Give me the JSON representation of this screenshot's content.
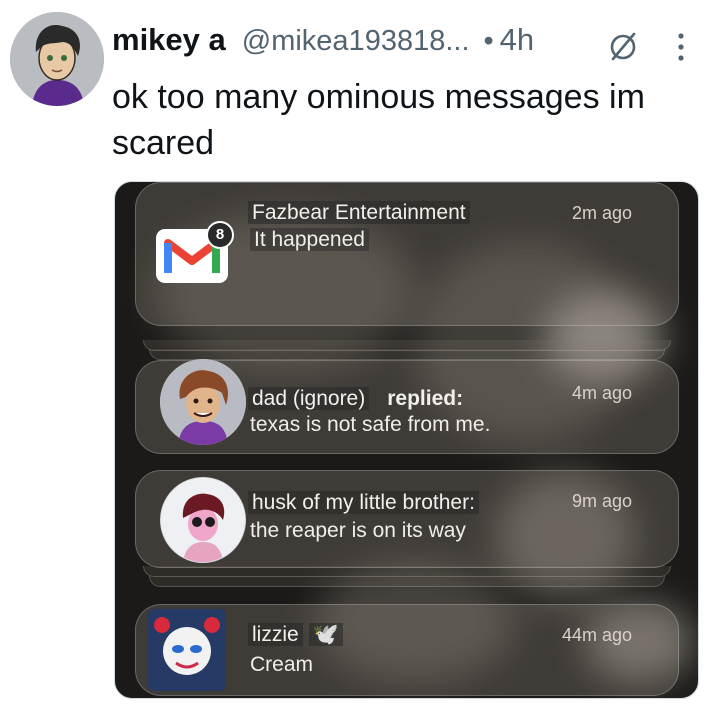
{
  "tweet": {
    "display_name": "mikey a",
    "handle": "@mikea193818...",
    "separator": "•",
    "age": "4h",
    "text": "ok too many ominous messages im scared",
    "icons": {
      "grok": "circle-slash-icon",
      "more": "vertical-dots-icon"
    }
  },
  "notifications": [
    {
      "app_icon": "gmail-icon",
      "badge_count": "8",
      "sender": "Fazbear Entertainment",
      "message": "It happened",
      "time": "2m ago"
    },
    {
      "sender": "dad (ignore)",
      "action": "replied:",
      "message": "texas is not safe from me.",
      "time": "4m ago"
    },
    {
      "sender": "husk of my little brother:",
      "message": "the reaper is on its way",
      "time": "9m ago"
    },
    {
      "sender": "lizzie",
      "sender_emoji": "🕊️",
      "message": "Cream",
      "time": "44m ago"
    }
  ],
  "colors": {
    "text_primary": "#0f1419",
    "text_secondary": "#536471",
    "gmail_red": "#ea4335",
    "badge": "#ffffff"
  }
}
